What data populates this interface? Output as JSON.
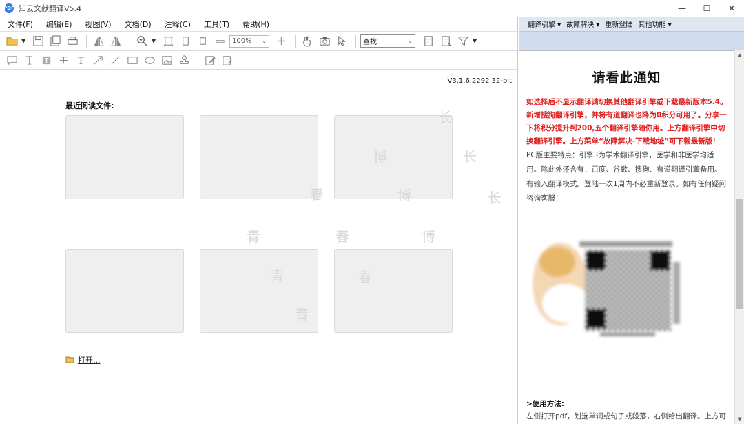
{
  "window": {
    "title": "知云文献翻译V5.4",
    "logo_text": "PDF"
  },
  "window_controls": {
    "minimize": "—",
    "maximize": "☐",
    "close": "✕"
  },
  "menu": [
    "文件(F)",
    "编辑(E)",
    "视图(V)",
    "文档(D)",
    "注释(C)",
    "工具(T)",
    "帮助(H)"
  ],
  "toolbar": {
    "zoom_value": "100%",
    "find_value": "查找"
  },
  "version": "V3.1.6.2292 32-bit",
  "recent": {
    "title": "最近阅读文件:"
  },
  "open_link": "打开...",
  "watermarks": [
    "长",
    "博",
    "长",
    "春",
    "博",
    "长",
    "青",
    "春",
    "博",
    "青",
    "春",
    "青"
  ],
  "right_panel": {
    "menu": [
      "翻译引擎 ▾",
      "故障解决 ▾",
      "重新登陆",
      "其他功能 ▾"
    ],
    "notice_title": "请看此通知",
    "notice_red": "如选择后不显示翻译请切换其他翻译引擎或下载最新版本5.4。新增搜狗翻译引擎，并将有道翻译也降为0积分可用了。分享一下将积分提升到200,五个翻译引擎随你用。上方翻译引擎中切换翻译引擎。上方菜单“故障解决-下载地址”可下载最新版！",
    "notice_body": "PC版主要特点：引擎3为学术翻译引擎，医学和非医学均适用。除此外还含有：百度、谷歌、搜狗、有道翻译引擎备用。有输入翻译模式。登陆一次1周内不必重新登录。如有任何疑问咨询客服！",
    "usage_title": ">使用方法:",
    "usage_body": "左侧打开pdf，划选单词或句子或段落，右侧给出翻译。上方可"
  }
}
